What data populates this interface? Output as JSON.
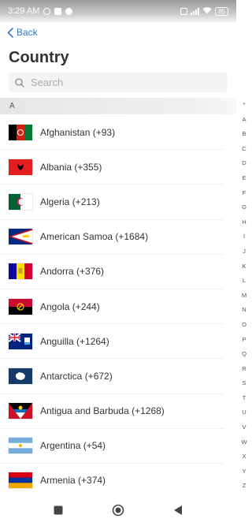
{
  "status_bar": {
    "time": "3:29 AM",
    "battery": "85"
  },
  "nav": {
    "back_label": "Back"
  },
  "page": {
    "title": "Country"
  },
  "search": {
    "placeholder": "Search"
  },
  "section": {
    "header": "A"
  },
  "countries": [
    {
      "label": "Afghanistan (+93)",
      "flag": "flag-afghanistan"
    },
    {
      "label": "Albania (+355)",
      "flag": "flag-albania"
    },
    {
      "label": "Algeria (+213)",
      "flag": "flag-algeria"
    },
    {
      "label": "American Samoa (+1684)",
      "flag": "flag-american-samoa"
    },
    {
      "label": "Andorra (+376)",
      "flag": "flag-andorra"
    },
    {
      "label": "Angola (+244)",
      "flag": "flag-angola"
    },
    {
      "label": "Anguilla (+1264)",
      "flag": "flag-anguilla"
    },
    {
      "label": "Antarctica (+672)",
      "flag": "flag-antarctica"
    },
    {
      "label": "Antigua and Barbuda (+1268)",
      "flag": "flag-antigua-and-barbuda"
    },
    {
      "label": "Argentina (+54)",
      "flag": "flag-argentina"
    },
    {
      "label": "Armenia (+374)",
      "flag": "flag-armenia"
    }
  ],
  "index_letters": [
    "*",
    "A",
    "B",
    "C",
    "D",
    "E",
    "F",
    "G",
    "H",
    "I",
    "J",
    "K",
    "L",
    "M",
    "N",
    "O",
    "P",
    "Q",
    "R",
    "S",
    "T",
    "U",
    "V",
    "W",
    "X",
    "Y",
    "Z"
  ],
  "colors": {
    "accent": "#3478c8",
    "title": "#333333",
    "section_bg": "#e6e6e6"
  }
}
